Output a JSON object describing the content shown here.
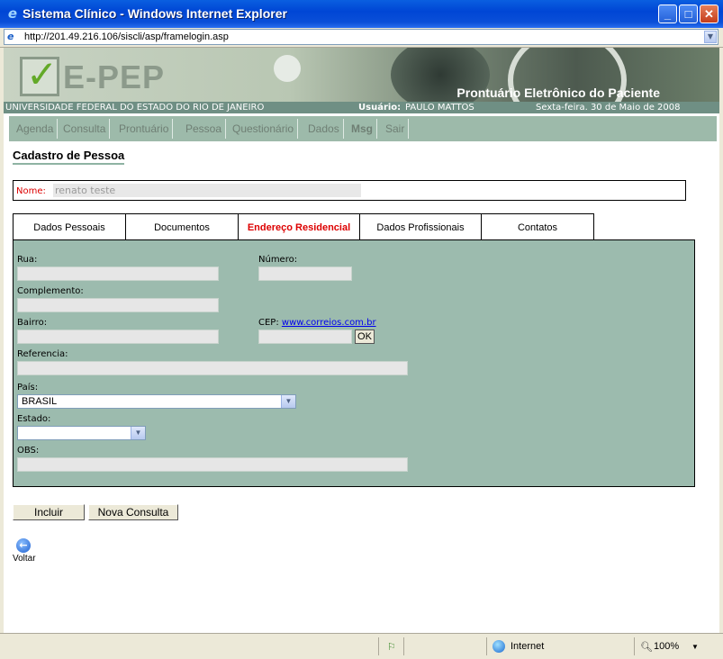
{
  "window": {
    "title": "Sistema Clínico - Windows Internet Explorer"
  },
  "address": {
    "url": "http://201.49.216.106/siscli/asp/framelogin.asp"
  },
  "banner": {
    "logo": "E-PEP",
    "subtitle": "Prontuário Eletrônico do Paciente"
  },
  "infobar": {
    "university": "UNIVERSIDADE FEDERAL DO ESTADO DO RIO DE JANEIRO",
    "user_label": "Usuário:",
    "user_name": "PAULO MATTOS",
    "date": "Sexta-feira. 30 de Maio de 2008"
  },
  "menu": {
    "items": [
      "Agenda",
      "Consulta",
      "Prontuário",
      "Pessoa",
      "Questionário",
      "Dados",
      "Msg",
      "Sair"
    ]
  },
  "page": {
    "title": "Cadastro de Pessoa"
  },
  "nome": {
    "label": "Nome:",
    "value": "renato teste"
  },
  "tabs": [
    "Dados Pessoais",
    "Documentos",
    "Endereço Residencial",
    "Dados Profissionais",
    "Contatos"
  ],
  "form": {
    "rua_label": "Rua:",
    "numero_label": "Número:",
    "complemento_label": "Complemento:",
    "bairro_label": "Bairro:",
    "cep_label": "CEP:",
    "cep_link": "www.correios.com.br",
    "ok_label": "OK",
    "referencia_label": "Referencia:",
    "pais_label": "País:",
    "pais_value": "BRASIL",
    "estado_label": "Estado:",
    "estado_value": "",
    "obs_label": "OBS:"
  },
  "actions": {
    "incluir": "Incluir",
    "nova_consulta": "Nova Consulta",
    "voltar": "Voltar"
  },
  "status": {
    "zone": "Internet",
    "zoom": "100%"
  }
}
